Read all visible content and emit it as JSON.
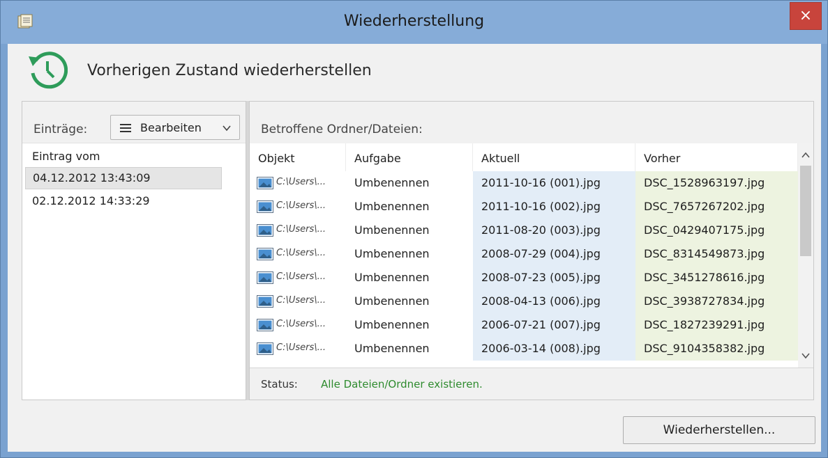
{
  "window": {
    "title": "Wiederherstellung",
    "close_label": "×"
  },
  "header": {
    "text": "Vorherigen Zustand wiederherstellen",
    "icon": "history-icon"
  },
  "left": {
    "label": "Einträge:",
    "edit_button": "Bearbeiten",
    "column_header": "Eintrag vom",
    "items": [
      {
        "label": "04.12.2012 13:43:09",
        "selected": true
      },
      {
        "label": "02.12.2012 14:33:29",
        "selected": false
      }
    ]
  },
  "right": {
    "title": "Betroffene Ordner/Dateien:",
    "columns": [
      "Objekt",
      "Aufgabe",
      "Aktuell",
      "Vorher"
    ],
    "rows": [
      {
        "path": "C:\\Users\\...",
        "task": "Umbenennen",
        "current": "2011-10-16 (001).jpg",
        "previous": "DSC_1528963197.jpg"
      },
      {
        "path": "C:\\Users\\...",
        "task": "Umbenennen",
        "current": "2011-10-16 (002).jpg",
        "previous": "DSC_7657267202.jpg"
      },
      {
        "path": "C:\\Users\\...",
        "task": "Umbenennen",
        "current": "2011-08-20 (003).jpg",
        "previous": "DSC_0429407175.jpg"
      },
      {
        "path": "C:\\Users\\...",
        "task": "Umbenennen",
        "current": "2008-07-29 (004).jpg",
        "previous": "DSC_8314549873.jpg"
      },
      {
        "path": "C:\\Users\\...",
        "task": "Umbenennen",
        "current": "2008-07-23 (005).jpg",
        "previous": "DSC_3451278616.jpg"
      },
      {
        "path": "C:\\Users\\...",
        "task": "Umbenennen",
        "current": "2008-04-13 (006).jpg",
        "previous": "DSC_3938727834.jpg"
      },
      {
        "path": "C:\\Users\\...",
        "task": "Umbenennen",
        "current": "2006-07-21 (007).jpg",
        "previous": "DSC_1827239291.jpg"
      },
      {
        "path": "C:\\Users\\...",
        "task": "Umbenennen",
        "current": "2006-03-14 (008).jpg",
        "previous": "DSC_9104358382.jpg"
      }
    ],
    "status_label": "Status:",
    "status_text": "Alle Dateien/Ordner existieren."
  },
  "footer": {
    "restore_button": "Wiederherstellen..."
  },
  "colors": {
    "accent_green": "#2e9c5a",
    "status_green": "#2e8b2e",
    "close_red": "#c8443c",
    "title_blue": "#86acd8"
  }
}
